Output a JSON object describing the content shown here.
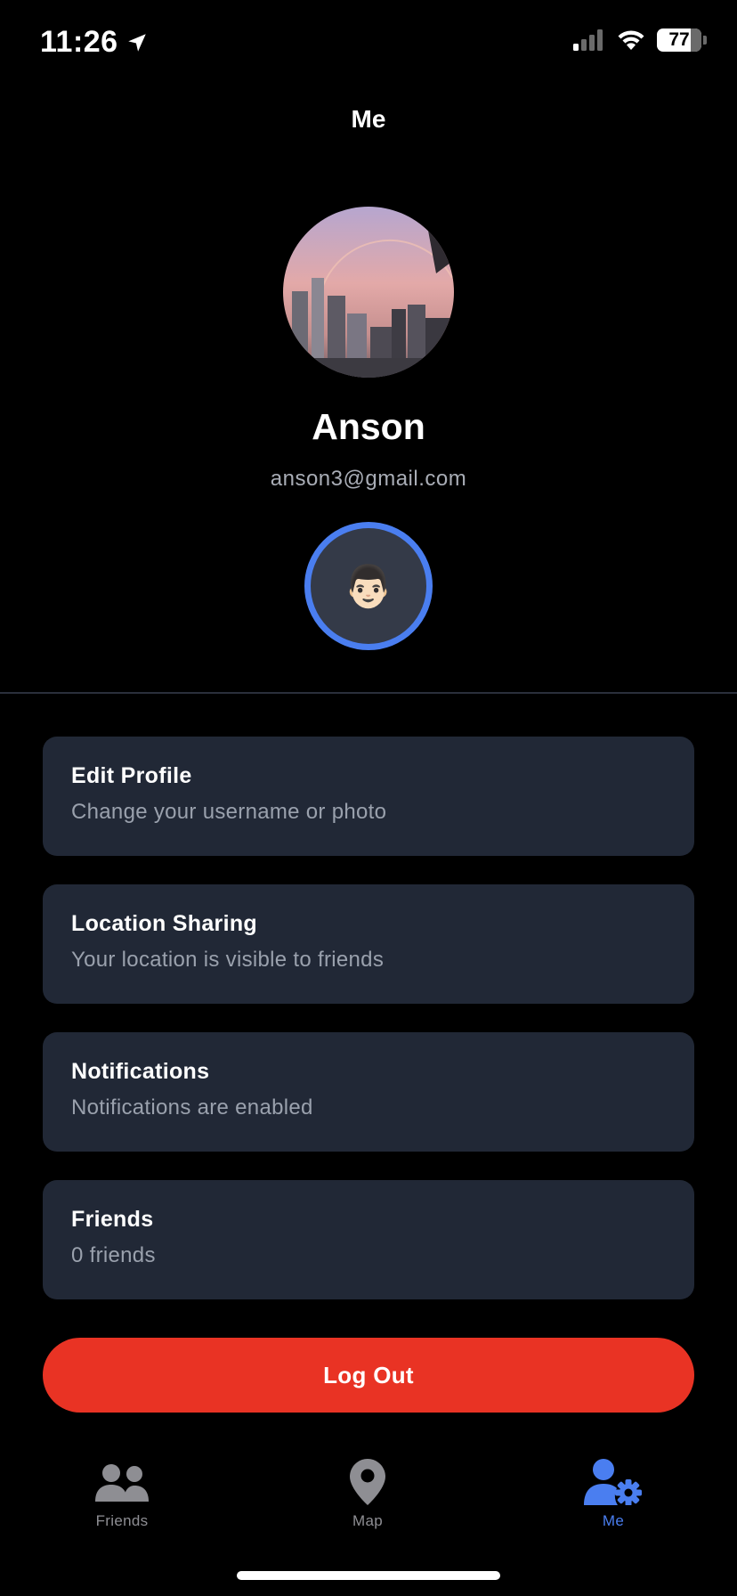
{
  "status_bar": {
    "time": "11:26",
    "battery": "77"
  },
  "header": {
    "title": "Me"
  },
  "profile": {
    "name": "Anson",
    "email": "anson3@gmail.com",
    "avatar_emoji": "👨🏻"
  },
  "menu": {
    "items": [
      {
        "title": "Edit Profile",
        "subtitle": "Change your username or photo"
      },
      {
        "title": "Location Sharing",
        "subtitle": "Your location is visible to friends"
      },
      {
        "title": "Notifications",
        "subtitle": "Notifications are enabled"
      },
      {
        "title": "Friends",
        "subtitle": "0 friends"
      }
    ]
  },
  "logout": {
    "label": "Log Out"
  },
  "tabs": [
    {
      "label": "Friends",
      "icon": "friends-icon",
      "active": false
    },
    {
      "label": "Map",
      "icon": "map-pin-icon",
      "active": false
    },
    {
      "label": "Me",
      "icon": "user-gear-icon",
      "active": true
    }
  ],
  "colors": {
    "accent": "#4a7ef0",
    "danger": "#e93324",
    "card": "#212836",
    "inactive_tab": "#8e8e93"
  }
}
